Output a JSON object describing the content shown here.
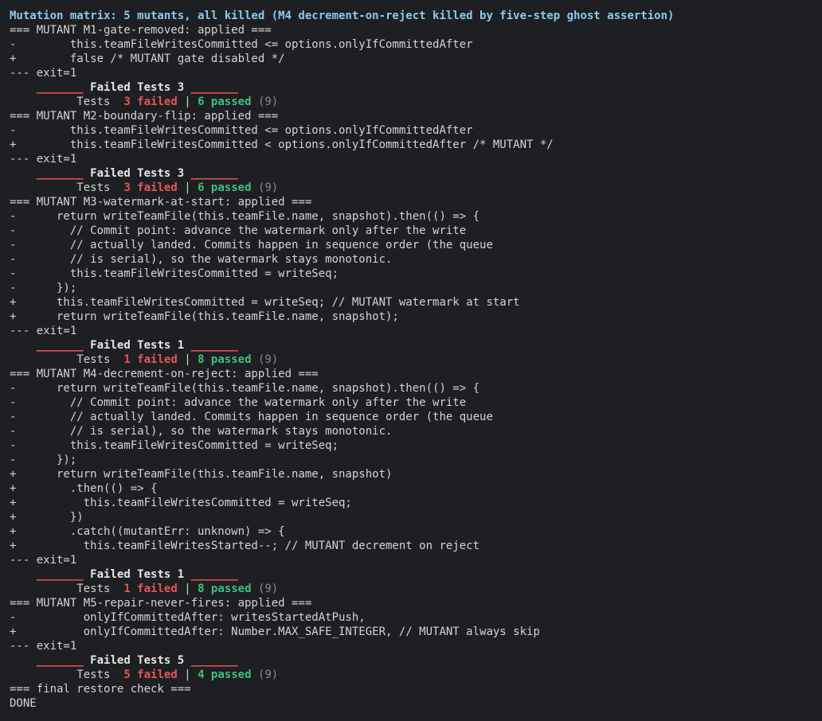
{
  "terminal": {
    "title": "Mutation matrix: 5 mutants, all killed (M4 decrement-on-reject killed by five-step ghost assertion)",
    "mutants": [
      {
        "header": "=== MUTANT M1-gate-removed: applied ===",
        "diff": [
          "-        this.teamFileWritesCommitted <= options.onlyIfCommittedAfter",
          "+        false /* MUTANT gate disabled */"
        ],
        "exit": "--- exit=1",
        "bar": "_______",
        "failed_header": "Failed Tests 3",
        "tests_label": "Tests",
        "failed": "3 failed",
        "sep": "|",
        "passed": "6 passed",
        "total": "(9)"
      },
      {
        "header": "=== MUTANT M2-boundary-flip: applied ===",
        "diff": [
          "-        this.teamFileWritesCommitted <= options.onlyIfCommittedAfter",
          "+        this.teamFileWritesCommitted < options.onlyIfCommittedAfter /* MUTANT */"
        ],
        "exit": "--- exit=1",
        "bar": "_______",
        "failed_header": "Failed Tests 3",
        "tests_label": "Tests",
        "failed": "3 failed",
        "sep": "|",
        "passed": "6 passed",
        "total": "(9)"
      },
      {
        "header": "=== MUTANT M3-watermark-at-start: applied ===",
        "diff": [
          "-      return writeTeamFile(this.teamFile.name, snapshot).then(() => {",
          "-        // Commit point: advance the watermark only after the write",
          "-        // actually landed. Commits happen in sequence order (the queue",
          "-        // is serial), so the watermark stays monotonic.",
          "-        this.teamFileWritesCommitted = writeSeq;",
          "-      });",
          "+      this.teamFileWritesCommitted = writeSeq; // MUTANT watermark at start",
          "+      return writeTeamFile(this.teamFile.name, snapshot);"
        ],
        "exit": "--- exit=1",
        "bar": "_______",
        "failed_header": "Failed Tests 1",
        "tests_label": "Tests",
        "failed": "1 failed",
        "sep": "|",
        "passed": "8 passed",
        "total": "(9)"
      },
      {
        "header": "=== MUTANT M4-decrement-on-reject: applied ===",
        "diff": [
          "-      return writeTeamFile(this.teamFile.name, snapshot).then(() => {",
          "-        // Commit point: advance the watermark only after the write",
          "-        // actually landed. Commits happen in sequence order (the queue",
          "-        // is serial), so the watermark stays monotonic.",
          "-        this.teamFileWritesCommitted = writeSeq;",
          "-      });",
          "+      return writeTeamFile(this.teamFile.name, snapshot)",
          "+        .then(() => {",
          "+          this.teamFileWritesCommitted = writeSeq;",
          "+        })",
          "+        .catch((mutantErr: unknown) => {",
          "+          this.teamFileWritesStarted--; // MUTANT decrement on reject"
        ],
        "exit": "--- exit=1",
        "bar": "_______",
        "failed_header": "Failed Tests 1",
        "tests_label": "Tests",
        "failed": "1 failed",
        "sep": "|",
        "passed": "8 passed",
        "total": "(9)"
      },
      {
        "header": "=== MUTANT M5-repair-never-fires: applied ===",
        "diff": [
          "-          onlyIfCommittedAfter: writesStartedAtPush,",
          "+          onlyIfCommittedAfter: Number.MAX_SAFE_INTEGER, // MUTANT always skip"
        ],
        "exit": "--- exit=1",
        "bar": "_______",
        "failed_header": "Failed Tests 5",
        "tests_label": "Tests",
        "failed": "5 failed",
        "sep": "|",
        "passed": "4 passed",
        "total": "(9)"
      }
    ],
    "final_check": "=== final restore check ===",
    "done": "DONE"
  },
  "colors": {
    "background": "#1e1f22",
    "title": "#8ec8ee",
    "failed": "#e45656",
    "passed": "#3fc07a",
    "dim": "#8a8a8a"
  }
}
